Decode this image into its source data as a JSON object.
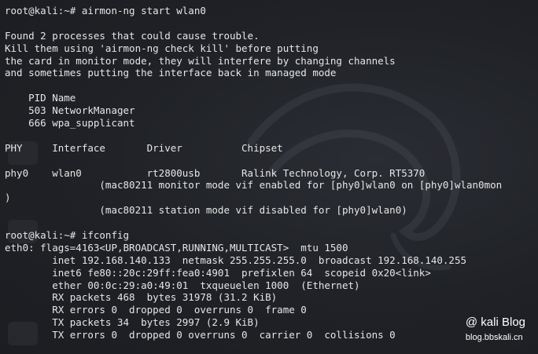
{
  "terminal": {
    "lines": [
      "root@kali:~# airmon-ng start wlan0",
      "",
      "Found 2 processes that could cause trouble.",
      "Kill them using 'airmon-ng check kill' before putting",
      "the card in monitor mode, they will interfere by changing channels",
      "and sometimes putting the interface back in managed mode",
      "",
      "    PID Name",
      "    503 NetworkManager",
      "    666 wpa_supplicant",
      "",
      "PHY     Interface       Driver          Chipset",
      "",
      "phy0    wlan0           rt2800usb       Ralink Technology, Corp. RT5370",
      "                (mac80211 monitor mode vif enabled for [phy0]wlan0 on [phy0]wlan0mon",
      ")",
      "                (mac80211 station mode vif disabled for [phy0]wlan0)",
      "",
      "root@kali:~# ifconfig",
      "eth0: flags=4163<UP,BROADCAST,RUNNING,MULTICAST>  mtu 1500",
      "        inet 192.168.140.133  netmask 255.255.255.0  broadcast 192.168.140.255",
      "        inet6 fe80::20c:29ff:fea0:4901  prefixlen 64  scopeid 0x20<link>",
      "        ether 00:0c:29:a0:49:01  txqueuelen 1000  (Ethernet)",
      "        RX packets 468  bytes 31978 (31.2 KiB)",
      "        RX errors 0  dropped 0  overruns 0  frame 0",
      "        TX packets 34  bytes 2997 (2.9 KiB)",
      "        TX errors 0  dropped 0 overruns 0  carrier 0  collisions 0"
    ]
  },
  "watermark": {
    "title": "@ kali Blog",
    "url": "blog.bbskali.cn"
  },
  "colors": {
    "background": "#1f2126",
    "text": "#e6e6e6"
  }
}
